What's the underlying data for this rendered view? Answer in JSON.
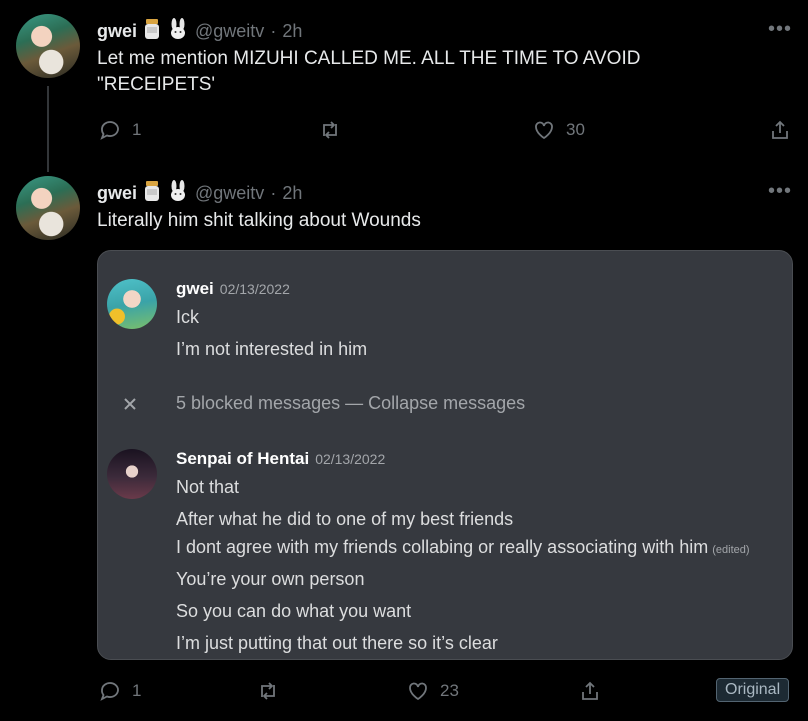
{
  "tweet1": {
    "name": "gwei",
    "handle": "@gweitv",
    "time": "2h",
    "text_line1": "Let me mention MIZUHI CALLED ME. ALL THE TIME TO AVOID",
    "text_line2": "\"RECEIPETS'",
    "replies": "1",
    "likes": "30"
  },
  "tweet2": {
    "name": "gwei",
    "handle": "@gweitv",
    "time": "2h",
    "text": "Literally him shit talking about Wounds",
    "replies": "1",
    "likes": "23",
    "badge": "Original"
  },
  "separator": "·",
  "more_label": "•••",
  "discord": {
    "msg1": {
      "author": "gwei",
      "timestamp": "02/13/2022",
      "lines": [
        "Ick",
        "I’m not interested in him"
      ]
    },
    "blocked": "5 blocked messages — Collapse messages",
    "msg2": {
      "author": "Senpai of Hentai",
      "timestamp": "02/13/2022",
      "lines": [
        "Not that",
        "After what he did to one of my best friends",
        "I dont agree with my friends collabing or really associating with him",
        "You’re your own person",
        "So you can do what you want",
        "I’m just putting that out there so it’s clear"
      ],
      "edited": "(edited)"
    }
  },
  "icons": [
    "reply-icon",
    "retweet-icon",
    "like-icon",
    "share-icon",
    "jar-emoji",
    "rabbit-emoji",
    "close-icon"
  ],
  "colors": {
    "background": "#000000",
    "card": "#36393f",
    "muted": "#71767b"
  }
}
